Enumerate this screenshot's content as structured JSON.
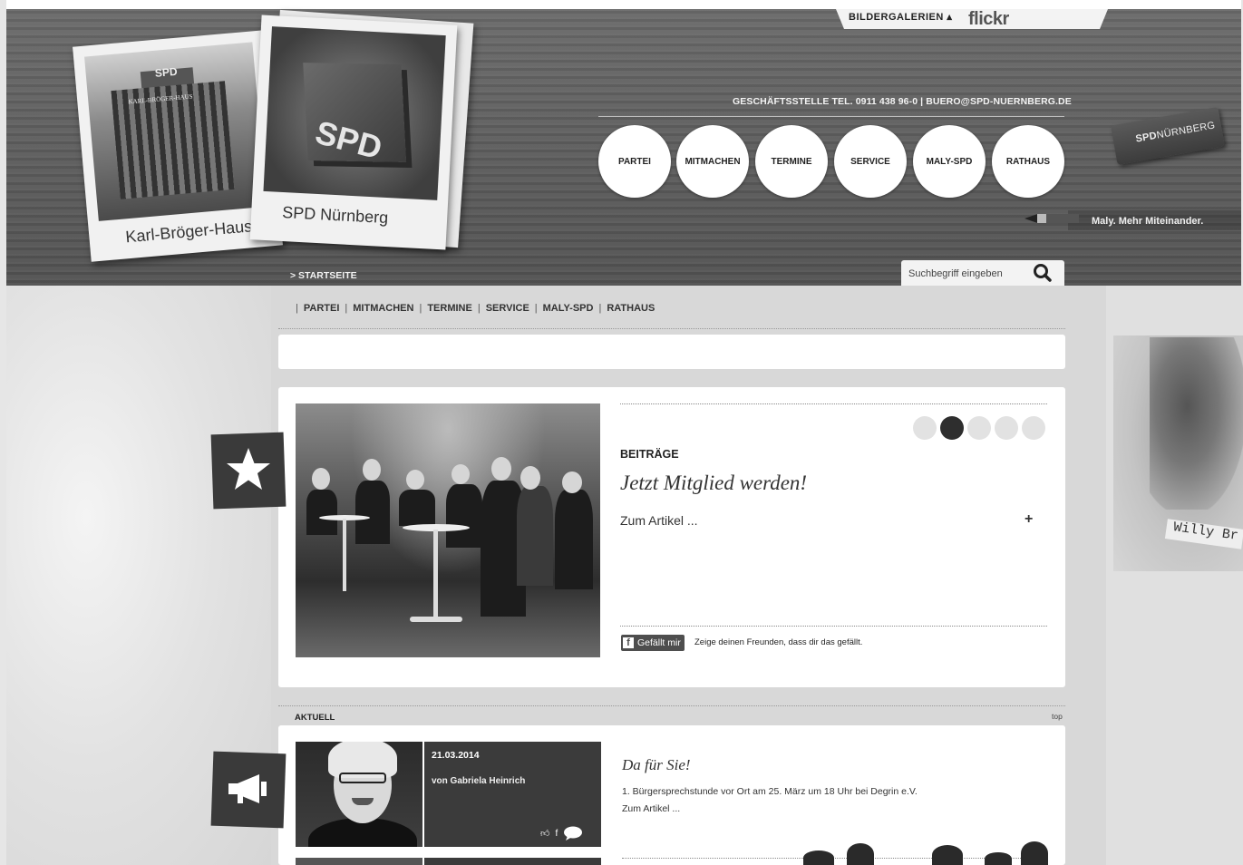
{
  "header": {
    "gallery_label": "BILDERGALERIEN",
    "flickr_label": "flickr",
    "contact": "GESCHÄFTSSTELLE TEL. 0911 438 96-0 | BUERO@SPD-NUERNBERG.DE",
    "polaroid_left_caption": "Karl-Bröger-Haus",
    "polaroid_left_photo_top": "SPD",
    "polaroid_left_photo_sign": "KARL-BRÖGER-HAUS",
    "polaroid_right_caption": "SPD Nürnberg",
    "polaroid_right_cube_text": "SPD",
    "nav": [
      "PARTEI",
      "MITMACHEN",
      "TERMINE",
      "SERVICE",
      "MALY-SPD",
      "RATHAUS"
    ],
    "eraser_bold": "SPD",
    "eraser_rest": "NÜRNBERG",
    "tagline": "Maly. Mehr Miteinander.",
    "breadcrumb": "> STARTSEITE",
    "search_placeholder": "Suchbegriff eingeben"
  },
  "subnav": [
    "PARTEI",
    "MITMACHEN",
    "TERMINE",
    "SERVICE",
    "MALY-SPD",
    "RATHAUS"
  ],
  "feature": {
    "category": "BEITRÄGE",
    "title": "Jetzt Mitglied werden!",
    "link": "Zum Artikel ...",
    "plus": "+",
    "slider_dots": 5,
    "active_dot": 2,
    "fb_button": "Gefällt mir",
    "fb_icon": "f",
    "fb_text": "Zeige deinen Freunden, dass dir das gefällt."
  },
  "aktuell": {
    "label": "AKTUELL",
    "top_link": "top",
    "item": {
      "date": "21.03.2014",
      "author": "von Gabriela Heinrich",
      "title": "Da für Sie!",
      "text": "1. Bürgersprechstunde vor Ort am 25. März um 18 Uhr bei Degrin e.V.",
      "link": "Zum Artikel ..."
    }
  },
  "side": {
    "brandt_label": "Willy Br"
  },
  "colors": {
    "header_wood": "#5e5e5e",
    "badge": "#3a3a3a",
    "card": "#ffffff",
    "column": "#d8d8d8"
  }
}
